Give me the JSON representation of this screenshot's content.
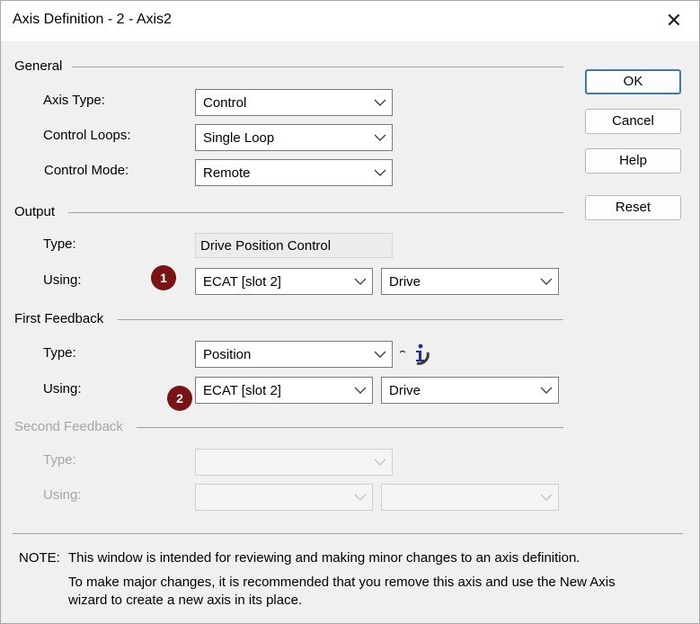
{
  "window": {
    "title": "Axis Definition - 2 - Axis2",
    "close_label": "✕"
  },
  "general": {
    "title": "General",
    "axis_type": {
      "label": "Axis Type:",
      "value": "Control"
    },
    "control_loops": {
      "label": "Control Loops:",
      "value": "Single Loop"
    },
    "control_mode": {
      "label": "Control Mode:",
      "value": "Remote"
    }
  },
  "output": {
    "title": "Output",
    "type": {
      "label": "Type:",
      "value": "Drive Position Control"
    },
    "using": {
      "label": "Using:",
      "marker": "1",
      "value": "ECAT [slot 2]",
      "secondary": "Drive"
    }
  },
  "first_feedback": {
    "title": "First Feedback",
    "type": {
      "label": "Type:",
      "value": "Position",
      "icon": "info-icon"
    },
    "using": {
      "label": "Using:",
      "marker": "2",
      "value": "ECAT [slot 2]",
      "secondary": "Drive"
    }
  },
  "second_feedback": {
    "title": "Second Feedback",
    "type": {
      "label": "Type:",
      "value": ""
    },
    "using": {
      "label": "Using:",
      "value": "",
      "secondary": ""
    }
  },
  "buttons": {
    "ok": "OK",
    "cancel": "Cancel",
    "help": "Help",
    "reset": "Reset"
  },
  "note": {
    "prefix": "NOTE:",
    "line1": "This window is intended for reviewing and making minor changes to an axis definition.",
    "line2": "To make major changes, it is recommended that you remove this axis and use the New Axis",
    "line3": "wizard to create a new axis in its place."
  },
  "colors": {
    "marker": "#7a1313",
    "default_button_border": "#3b78c6",
    "disabled_text": "#a6a6a6"
  }
}
